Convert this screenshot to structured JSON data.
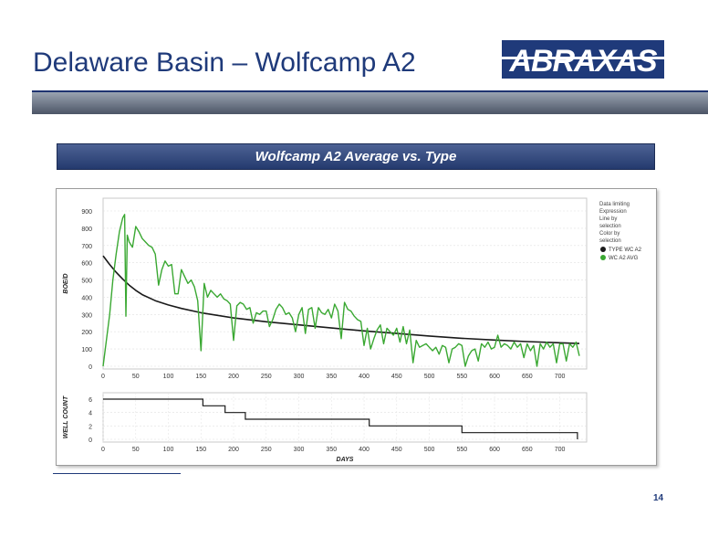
{
  "slide": {
    "title": "Delaware Basin – Wolfcamp A2",
    "logo_text": "ABRAXAS",
    "header": "Wolfcamp A2 Average vs. Type",
    "page_number": "14"
  },
  "colors": {
    "title": "#1f3a7a",
    "type_curve": "#1a1a1a",
    "avg_curve": "#3aa832",
    "well_count": "#1a1a1a"
  },
  "legend": {
    "lines": [
      "Data limiting",
      "Expression",
      "Line by",
      "selection",
      "Color by",
      "selection"
    ],
    "items": [
      {
        "label": "TYPE WC A2",
        "color": "#1a1a1a"
      },
      {
        "label": "WC A2 AVG",
        "color": "#3aa832"
      }
    ]
  },
  "chart_data": [
    {
      "type": "line",
      "ylabel": "BOE/D",
      "xlim": [
        0,
        730
      ],
      "ylim": [
        0,
        900
      ],
      "x_ticks": [
        0,
        50,
        100,
        150,
        200,
        250,
        300,
        350,
        400,
        450,
        500,
        550,
        600,
        650,
        700
      ],
      "y_ticks": [
        0,
        100,
        200,
        300,
        400,
        500,
        600,
        700,
        800,
        900
      ],
      "legend_position": "top-right",
      "series": [
        {
          "name": "TYPE WC A2",
          "x": [
            0,
            10,
            20,
            30,
            40,
            50,
            60,
            80,
            100,
            120,
            150,
            200,
            250,
            300,
            350,
            400,
            450,
            500,
            550,
            600,
            650,
            700,
            730
          ],
          "y": [
            640,
            590,
            545,
            505,
            470,
            440,
            415,
            380,
            355,
            335,
            310,
            280,
            258,
            240,
            222,
            205,
            190,
            175,
            162,
            152,
            143,
            136,
            132
          ]
        },
        {
          "name": "WC A2 AVG",
          "x": [
            0,
            5,
            10,
            15,
            20,
            25,
            30,
            33,
            35,
            37,
            40,
            45,
            50,
            55,
            60,
            65,
            70,
            75,
            80,
            85,
            90,
            95,
            100,
            105,
            110,
            115,
            120,
            125,
            130,
            135,
            140,
            145,
            150,
            155,
            160,
            165,
            170,
            175,
            180,
            185,
            190,
            195,
            200,
            205,
            210,
            215,
            220,
            225,
            230,
            235,
            240,
            245,
            250,
            255,
            260,
            265,
            270,
            275,
            280,
            285,
            290,
            295,
            300,
            305,
            310,
            315,
            320,
            325,
            330,
            335,
            340,
            345,
            350,
            355,
            360,
            365,
            370,
            375,
            380,
            385,
            390,
            395,
            400,
            405,
            410,
            415,
            420,
            425,
            430,
            435,
            440,
            445,
            450,
            455,
            460,
            465,
            470,
            475,
            480,
            485,
            490,
            495,
            500,
            505,
            510,
            515,
            520,
            525,
            530,
            535,
            540,
            545,
            550,
            555,
            560,
            565,
            570,
            575,
            580,
            585,
            590,
            595,
            600,
            605,
            610,
            615,
            620,
            625,
            630,
            635,
            640,
            645,
            650,
            655,
            660,
            665,
            670,
            675,
            680,
            685,
            690,
            695,
            700,
            705,
            710,
            715,
            720,
            725,
            730
          ],
          "y": [
            0,
            150,
            300,
            500,
            650,
            780,
            860,
            880,
            290,
            760,
            720,
            690,
            810,
            780,
            740,
            720,
            700,
            690,
            650,
            470,
            560,
            610,
            580,
            590,
            420,
            420,
            560,
            520,
            480,
            500,
            460,
            380,
            90,
            480,
            400,
            440,
            420,
            400,
            420,
            390,
            380,
            360,
            150,
            350,
            370,
            360,
            330,
            340,
            250,
            310,
            300,
            320,
            320,
            230,
            270,
            330,
            360,
            340,
            300,
            310,
            280,
            200,
            300,
            340,
            190,
            330,
            340,
            220,
            340,
            310,
            300,
            330,
            280,
            360,
            320,
            160,
            370,
            330,
            320,
            290,
            270,
            260,
            120,
            220,
            100,
            160,
            210,
            240,
            130,
            220,
            200,
            180,
            220,
            140,
            230,
            130,
            210,
            20,
            150,
            110,
            120,
            130,
            110,
            90,
            110,
            70,
            120,
            110,
            20,
            100,
            110,
            130,
            120,
            0,
            60,
            90,
            100,
            30,
            130,
            110,
            140,
            100,
            110,
            180,
            110,
            130,
            120,
            100,
            140,
            110,
            130,
            50,
            130,
            90,
            120,
            0,
            130,
            100,
            140,
            110,
            130,
            20,
            130,
            130,
            30,
            130,
            110,
            140,
            60
          ]
        }
      ]
    },
    {
      "type": "line",
      "ylabel": "WELL COUNT",
      "xlabel": "DAYS",
      "xlim": [
        0,
        730
      ],
      "ylim": [
        0,
        6
      ],
      "x_ticks": [
        0,
        50,
        100,
        150,
        200,
        250,
        300,
        350,
        400,
        450,
        500,
        550,
        600,
        650,
        700
      ],
      "y_ticks": [
        0,
        2,
        4,
        6
      ],
      "series": [
        {
          "name": "WELL COUNT",
          "x": [
            0,
            153,
            153,
            187,
            187,
            218,
            218,
            408,
            408,
            550,
            550,
            727,
            727
          ],
          "y": [
            6,
            6,
            5,
            5,
            4,
            4,
            3,
            3,
            2,
            2,
            1,
            1,
            0
          ]
        }
      ]
    }
  ]
}
